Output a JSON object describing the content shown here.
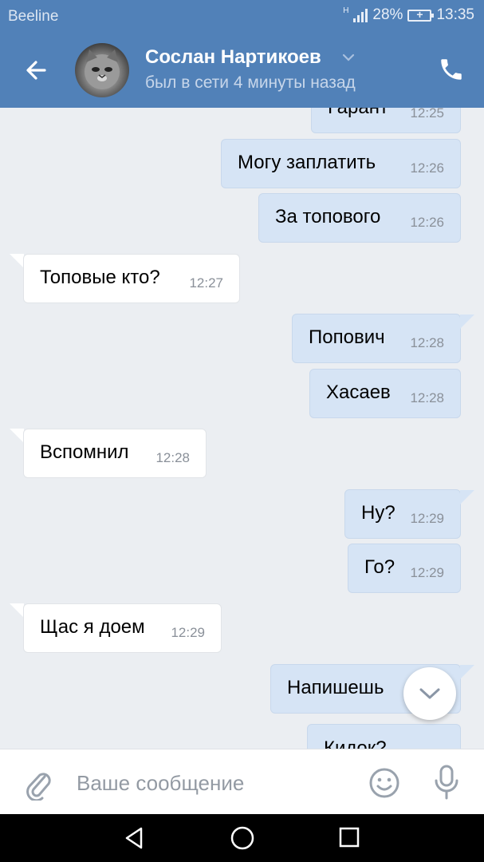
{
  "status_bar": {
    "carrier": "Beeline",
    "network": "H",
    "battery_percent": "28%",
    "time": "13:35"
  },
  "header": {
    "contact_name": "Сослан Нартикоев",
    "contact_status": "был в сети 4 минуты назад"
  },
  "messages": [
    {
      "direction": "out",
      "text": "Гарант",
      "time": "12:25"
    },
    {
      "direction": "out",
      "text": "Могу заплатить",
      "time": "12:26"
    },
    {
      "direction": "out",
      "text": "За топового",
      "time": "12:26"
    },
    {
      "direction": "in",
      "text": "Топовые кто?",
      "time": "12:27"
    },
    {
      "direction": "out",
      "text": "Попович",
      "time": "12:28"
    },
    {
      "direction": "out",
      "text": "Хасаев",
      "time": "12:28"
    },
    {
      "direction": "in",
      "text": "Вспомнил",
      "time": "12:28"
    },
    {
      "direction": "out",
      "text": "Ну?",
      "time": "12:29"
    },
    {
      "direction": "out",
      "text": "Го?",
      "time": "12:29"
    },
    {
      "direction": "in",
      "text": "Щас я доем",
      "time": "12:29"
    },
    {
      "direction": "out",
      "text": "Напишешь",
      "time": ""
    },
    {
      "direction": "out",
      "text": "Кидок?",
      "time": ""
    }
  ],
  "composer": {
    "placeholder": "Ваше сообщение"
  },
  "icons": {
    "back": "arrow-left-icon",
    "call": "phone-icon",
    "attach": "paperclip-icon",
    "emoji": "smiley-icon",
    "mic": "microphone-icon",
    "scroll": "chevron-down-icon"
  },
  "colors": {
    "header": "#5181b8",
    "outgoing_bubble": "#d6e4f5",
    "incoming_bubble": "#ffffff",
    "background": "#ebeef2"
  }
}
